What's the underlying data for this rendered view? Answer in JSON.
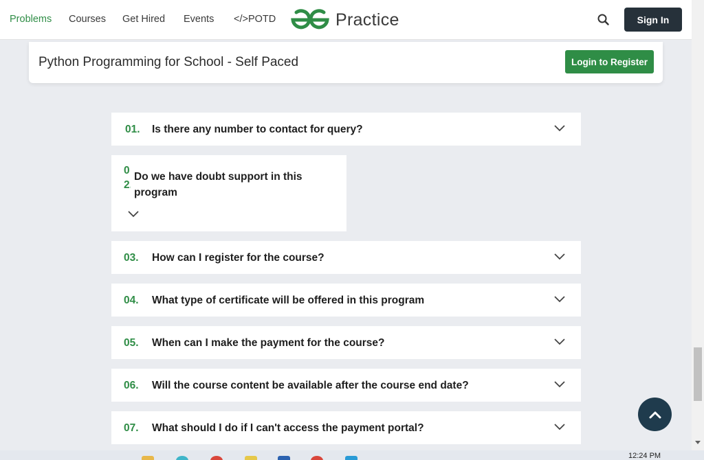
{
  "nav": {
    "items": [
      {
        "label": "Problems",
        "active": true
      },
      {
        "label": "Courses",
        "active": false
      },
      {
        "label": "Get Hired",
        "active": false
      },
      {
        "label": "Events",
        "active": false
      },
      {
        "label": "</>POTD",
        "active": false
      }
    ],
    "logo_text": "Practice",
    "logo_icon": "gfg-logo-icon",
    "search_icon": "search-icon",
    "signin_label": "Sign In"
  },
  "course_bar": {
    "title": "Python Programming for School - Self Paced",
    "login_label": "Login to Register"
  },
  "faq": {
    "items": [
      {
        "num": "01.",
        "question": "Is there any number to contact for query?"
      },
      {
        "num": "02.",
        "question": "Do we have doubt support in this program"
      },
      {
        "num": "03.",
        "question": "How can I register for the course?"
      },
      {
        "num": "04.",
        "question": "What type of certificate will be offered in this program"
      },
      {
        "num": "05.",
        "question": "When can I make the payment for the course?"
      },
      {
        "num": "06.",
        "question": "Will the course content be available after the course end date?"
      },
      {
        "num": "07.",
        "question": "What should I do if I can't access the payment portal?"
      }
    ]
  },
  "taskbar": {
    "time": "12:24 PM"
  },
  "colors": {
    "brand_green": "#2f8d46",
    "dark_button": "#26313a",
    "back_to_top": "#1f3b4d",
    "page_bg": "#eaecf0"
  }
}
